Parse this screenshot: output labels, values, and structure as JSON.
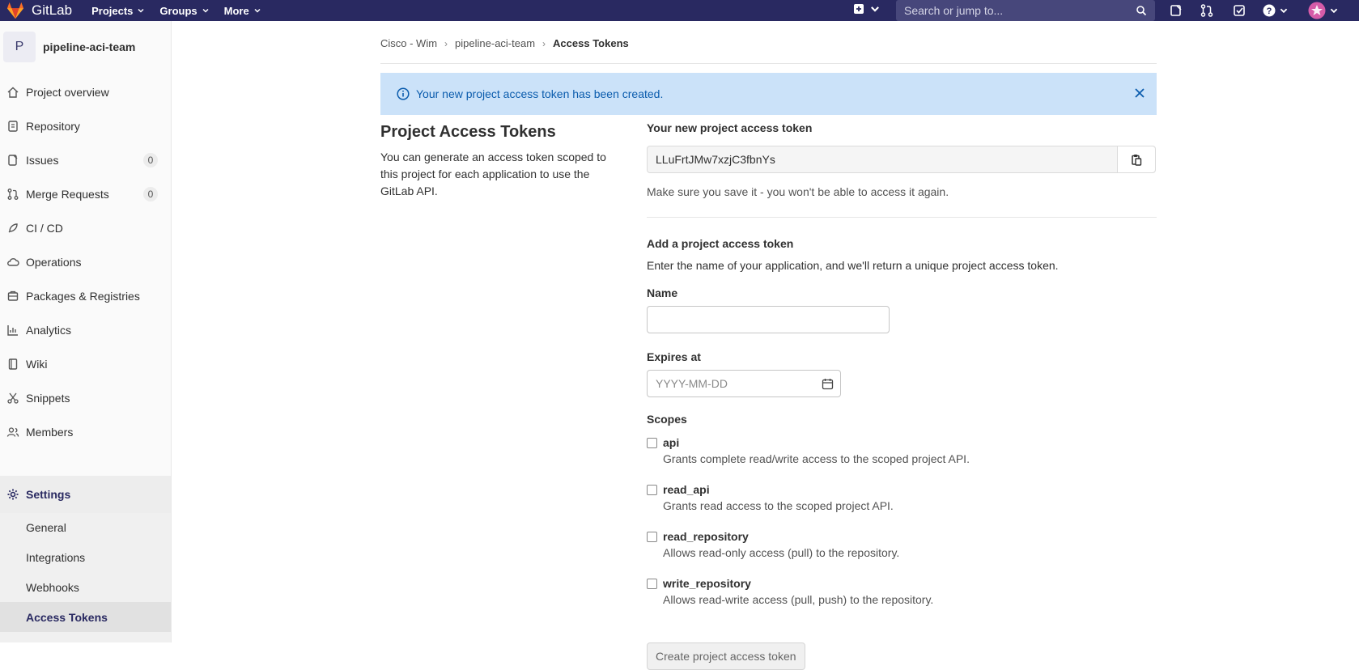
{
  "topbar": {
    "brand": "GitLab",
    "nav": [
      {
        "label": "Projects"
      },
      {
        "label": "Groups"
      },
      {
        "label": "More"
      }
    ],
    "search_placeholder": "Search or jump to..."
  },
  "sidebar": {
    "avatar_letter": "P",
    "project_name": "pipeline-aci-team",
    "items": [
      {
        "label": "Project overview",
        "icon": "home-icon"
      },
      {
        "label": "Repository",
        "icon": "doc-icon"
      },
      {
        "label": "Issues",
        "icon": "issues-icon",
        "count": "0"
      },
      {
        "label": "Merge Requests",
        "icon": "merge-request-icon",
        "count": "0"
      },
      {
        "label": "CI / CD",
        "icon": "rocket-icon"
      },
      {
        "label": "Operations",
        "icon": "cloud-icon"
      },
      {
        "label": "Packages & Registries",
        "icon": "package-icon"
      },
      {
        "label": "Analytics",
        "icon": "chart-icon"
      },
      {
        "label": "Wiki",
        "icon": "book-icon"
      },
      {
        "label": "Snippets",
        "icon": "scissors-icon"
      },
      {
        "label": "Members",
        "icon": "users-icon"
      }
    ],
    "settings_label": "Settings",
    "settings_sub": [
      {
        "label": "General"
      },
      {
        "label": "Integrations"
      },
      {
        "label": "Webhooks"
      },
      {
        "label": "Access Tokens"
      }
    ]
  },
  "breadcrumb": [
    "Cisco - Wim",
    "pipeline-aci-team",
    "Access Tokens"
  ],
  "alert": {
    "message": "Your new project access token has been created."
  },
  "left": {
    "title": "Project Access Tokens",
    "description": "You can generate an access token scoped to this project for each application to use the GitLab API."
  },
  "new_token": {
    "label": "Your new project access token",
    "value": "LLuFrtJMw7xzjC3fbnYs",
    "help": "Make sure you save it - you won't be able to access it again."
  },
  "add_token": {
    "title": "Add a project access token",
    "description": "Enter the name of your application, and we'll return a unique project access token.",
    "name_label": "Name",
    "expires_label": "Expires at",
    "expires_placeholder": "YYYY-MM-DD",
    "scopes_label": "Scopes",
    "scopes": [
      {
        "name": "api",
        "description": "Grants complete read/write access to the scoped project API."
      },
      {
        "name": "read_api",
        "description": "Grants read access to the scoped project API."
      },
      {
        "name": "read_repository",
        "description": "Allows read-only access (pull) to the repository."
      },
      {
        "name": "write_repository",
        "description": "Allows read-write access (pull, push) to the repository."
      }
    ],
    "submit_label": "Create project access token"
  },
  "colors": {
    "topbar": "#292961",
    "alert_bg": "#cbe2f9",
    "alert_text": "#0b5cad",
    "brand_orange": "#e24329"
  }
}
